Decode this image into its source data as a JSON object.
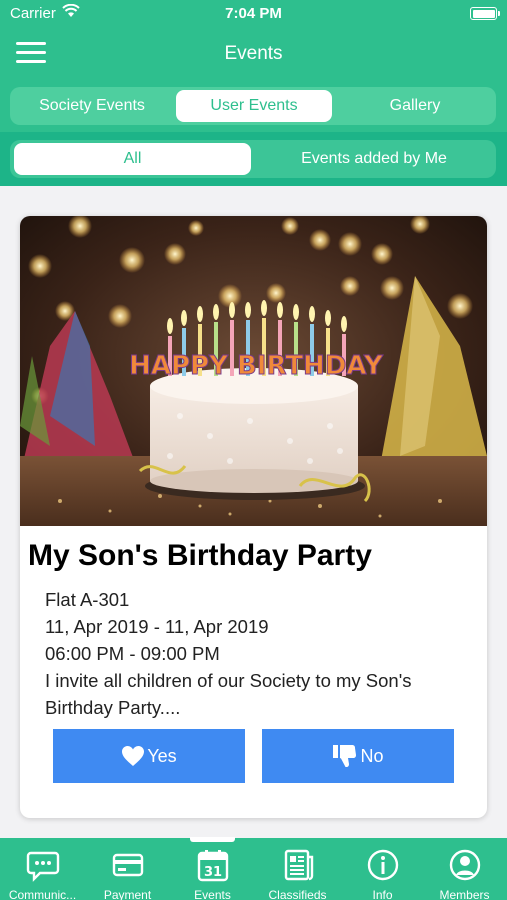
{
  "status_bar": {
    "carrier": "Carrier",
    "time": "7:04 PM"
  },
  "nav": {
    "title": "Events"
  },
  "top_tabs": [
    {
      "label": "Society Events",
      "active": false
    },
    {
      "label": "User Events",
      "active": true
    },
    {
      "label": "Gallery",
      "active": false
    }
  ],
  "filter_tabs": [
    {
      "label": "All",
      "active": true
    },
    {
      "label": "Events added by Me",
      "active": false
    }
  ],
  "event": {
    "image_text": "HAPPY BIRTHDAY",
    "title": "My Son's Birthday Party",
    "flat": "Flat A-301",
    "date_range": "11, Apr 2019 - 11, Apr 2019",
    "time_range": "06:00 PM - 09:00 PM",
    "description": "I invite all children of our Society to my Son's Birthday Party....",
    "yes_label": "Yes",
    "no_label": "No"
  },
  "bottom_tabs": [
    {
      "label": "Communic...",
      "icon": "chat-icon"
    },
    {
      "label": "Payment",
      "icon": "credit-card-icon"
    },
    {
      "label": "Events",
      "icon": "calendar-icon",
      "icon_text": "31",
      "active": true
    },
    {
      "label": "Classifieds",
      "icon": "newspaper-icon"
    },
    {
      "label": "Info",
      "icon": "info-icon"
    },
    {
      "label": "Members",
      "icon": "user-icon"
    }
  ],
  "colors": {
    "primary": "#2ebf8e",
    "button": "#3f8af2"
  }
}
